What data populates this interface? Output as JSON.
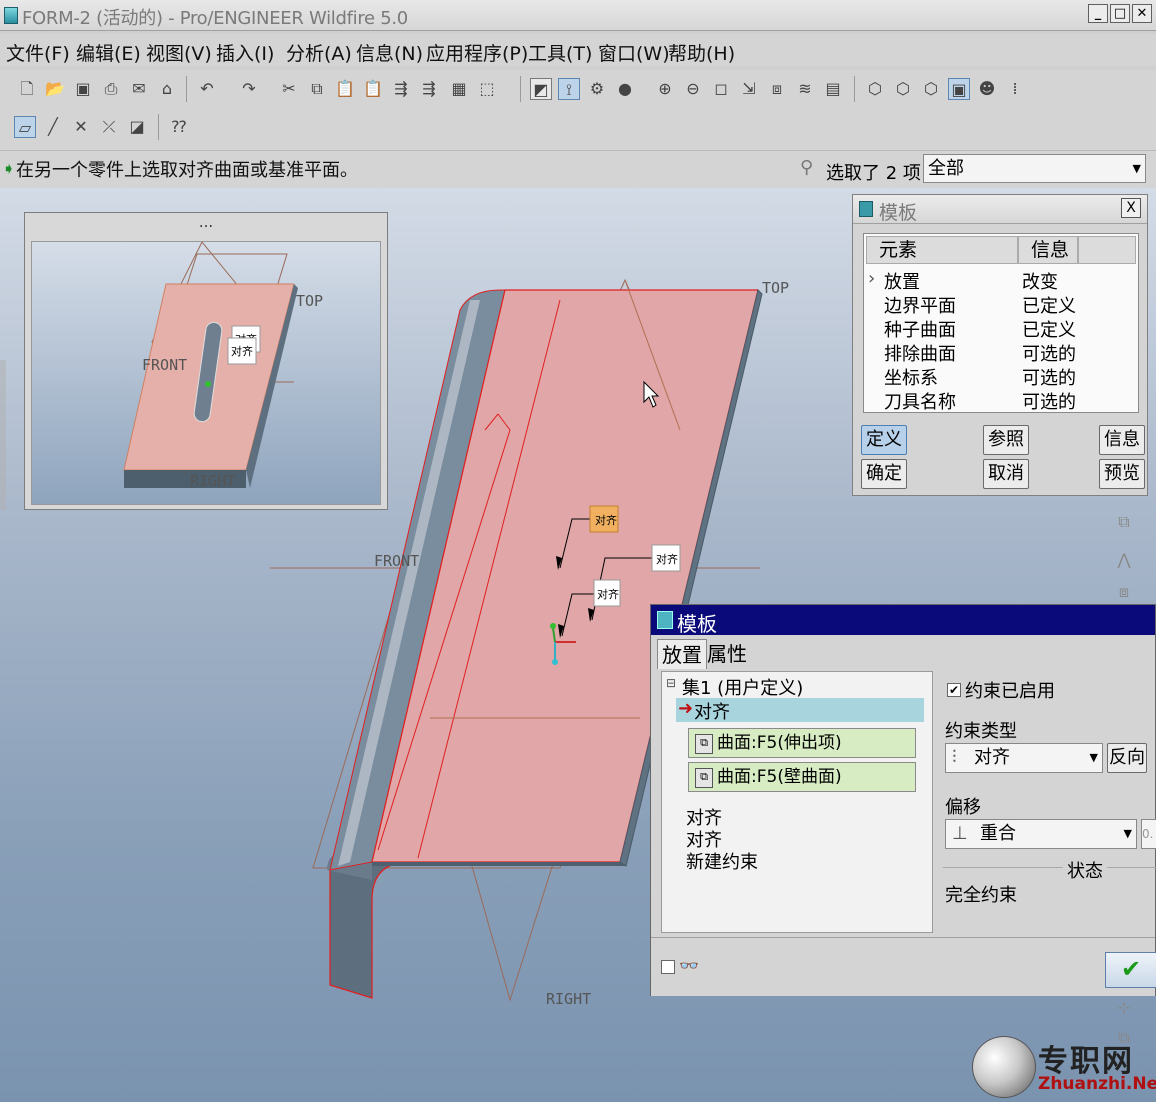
{
  "window": {
    "title": "FORM-2 (活动的) - Pro/ENGINEER Wildfire 5.0",
    "btn_min": "_",
    "btn_max": "□",
    "btn_close": "✕"
  },
  "menu": [
    "文件(F)",
    "编辑(E)",
    "视图(V)",
    "插入(I)",
    "分析(A)",
    "信息(N)",
    "应用程序(P)",
    "工具(T)",
    "窗口(W)",
    "帮助(H)"
  ],
  "message": {
    "prompt": "在另一个零件上选取对齐曲面或基准平面。",
    "selected_text": "选取了 2 项",
    "filter_value": "全部"
  },
  "thumbnail": {
    "header": "...",
    "labels": {
      "top": "TOP",
      "front": "FRONT",
      "right": "RIGHT",
      "align1": "对齐",
      "align2": "对齐"
    }
  },
  "model_labels": {
    "top": "TOP",
    "front": "FRONT",
    "right": "RIGHT",
    "align1": "对齐",
    "align2": "对齐",
    "align3": "对齐"
  },
  "template_panel": {
    "title": "模板",
    "close": "X",
    "col_element": "元素",
    "col_info": "信息",
    "rows": [
      {
        "element": "放置",
        "info": "改变"
      },
      {
        "element": "边界平面",
        "info": "已定义"
      },
      {
        "element": "种子曲面",
        "info": "已定义"
      },
      {
        "element": "排除曲面",
        "info": "可选的"
      },
      {
        "element": "坐标系",
        "info": "可选的"
      },
      {
        "element": "刀具名称",
        "info": "可选的"
      }
    ],
    "buttons": {
      "define": "定义",
      "refs": "参照",
      "info": "信息",
      "ok": "确定",
      "cancel": "取消",
      "preview": "预览"
    }
  },
  "placement_dialog": {
    "title": "模板",
    "tab_placement": "放置",
    "tab_properties": "属性",
    "set_label": "集1 (用户定义)",
    "selected_constraint": "对齐",
    "ref1": "曲面:F5(伸出项)",
    "ref2": "曲面:F5(壁曲面)",
    "constraints": [
      "对齐",
      "对齐"
    ],
    "new_constraint": "新建约束",
    "enabled_label": "约束已启用",
    "enabled": true,
    "type_label": "约束类型",
    "type_value": "对齐",
    "flip_button": "反向",
    "offset_label": "偏移",
    "offset_value": "重合",
    "offset_field": "0.",
    "status_label": "状态",
    "status_value": "完全约束"
  },
  "watermark": {
    "cn": "专职网",
    "url": "Zhuanzhi.Net"
  },
  "colors": {
    "part_face": "#e0a6a8",
    "edge_red": "#e02020",
    "dialog_header": "#0a0a7a",
    "accent_green": "#1c9a1c"
  }
}
